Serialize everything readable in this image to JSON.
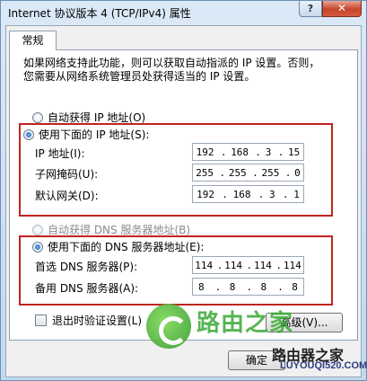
{
  "window": {
    "title": "Internet 协议版本 4 (TCP/IPv4) 属性",
    "help_label": "?",
    "close_label": "✕"
  },
  "tab": {
    "label": "常规"
  },
  "description": {
    "line1": "如果网络支持此功能，则可以获取自动指派的 IP 设置。否则，",
    "line2": "您需要从网络系统管理员处获得适当的 IP 设置。"
  },
  "ip_section": {
    "auto_option": "自动获得 IP 地址(O)",
    "manual_option": "使用下面的 IP 地址(S):",
    "fields": [
      {
        "label": "IP 地址(I):",
        "octets": [
          "192",
          "168",
          "3",
          "15"
        ]
      },
      {
        "label": "子网掩码(U):",
        "octets": [
          "255",
          "255",
          "255",
          "0"
        ]
      },
      {
        "label": "默认网关(D):",
        "octets": [
          "192",
          "168",
          "3",
          "1"
        ]
      }
    ]
  },
  "dns_section": {
    "auto_option": "自动获得 DNS 服务器地址(B)",
    "manual_option": "使用下面的 DNS 服务器地址(E):",
    "fields": [
      {
        "label": "首选 DNS 服务器(P):",
        "octets": [
          "114",
          "114",
          "114",
          "114"
        ]
      },
      {
        "label": "备用 DNS 服务器(A):",
        "octets": [
          "8",
          "8",
          "8",
          "8"
        ]
      }
    ]
  },
  "validate_checkbox": {
    "label": "退出时验证设置(L)"
  },
  "buttons": {
    "advanced": "高级(V)...",
    "ok": "确定"
  },
  "watermark": {
    "text": "路由之家",
    "logo": "路由器之家",
    "url": "LUYOUQI520.COM"
  },
  "colors": {
    "highlight_frame": "#c0241d",
    "watermark_green": "#39a935"
  }
}
